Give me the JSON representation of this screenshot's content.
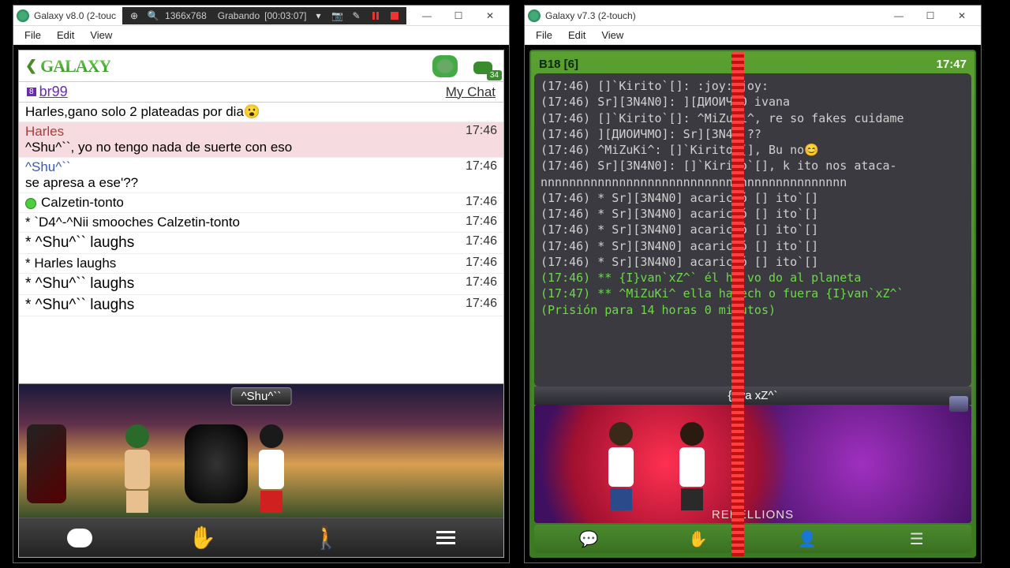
{
  "left_window": {
    "title": "Galaxy v8.0 (2-touc",
    "rec": {
      "res": "1366x768",
      "label": "Grabando",
      "time": "[00:03:07]"
    },
    "menu": [
      "File",
      "Edit",
      "View"
    ],
    "header": {
      "logo": "GALAXY",
      "people_badge": "34"
    },
    "sub": {
      "room_tag": "8",
      "room": "br99",
      "mychat": "My Chat"
    },
    "messages": [
      {
        "type": "plain",
        "text": "Harles,gano solo 2 plateadas por dia😮",
        "time": ""
      },
      {
        "type": "named",
        "name": "Harles",
        "name_class": "name-red",
        "text": "^Shu^``, yo no tengo nada de suerte con eso",
        "row_class": "pink",
        "time": "17:46"
      },
      {
        "type": "named",
        "name": "^Shu^``",
        "name_class": "name-blue",
        "text": "se apresa a ese'??",
        "time": "17:46"
      },
      {
        "type": "status",
        "text": "Calzetin-tonto",
        "dot": true,
        "time": "17:46"
      },
      {
        "type": "emote",
        "text": "* `D4^-^Nii smooches Calzetin-tonto",
        "time": "17:46"
      },
      {
        "type": "emote",
        "text": "* ^Shu^`` laughs",
        "time": "17:46",
        "big": true
      },
      {
        "type": "emote",
        "text": "* Harles laughs",
        "time": "17:46"
      },
      {
        "type": "emote",
        "text": "* ^Shu^`` laughs",
        "time": "17:46",
        "big": true
      },
      {
        "type": "emote",
        "text": "* ^Shu^`` laughs",
        "time": "17:46",
        "big": true
      }
    ],
    "selected_avatar": "^Shu^``"
  },
  "right_window": {
    "title": "Galaxy v7.3 (2-touch)",
    "menu": [
      "File",
      "Edit",
      "View"
    ],
    "top": {
      "room": "B18 [6]",
      "clock": "17:47"
    },
    "lines": [
      "(17:46) []`Kirito`[]: :joy::joy:",
      "(17:46) Sr][3N4N0]: ][ДИОИЧМО     ivana",
      "(17:46) []`Kirito`[]: ^MiZuKi^, re   so fakes cuidame",
      "(17:46) ][ДИОИЧМО]: Sr][3N4N   ??",
      "(17:46) ^MiZuKi^: []`Kirito`[], Bu   no😊",
      "(17:46) Sr][3N4N0]: []`Kirito`[], k  ito nos ataca-nnnnnnnnnnnnnnnnnnnnnnnnnnnnnnnnnnnnnnnnnnn",
      "(17:46) * Sr][3N4N0] acarició []   ito`[]",
      "(17:46) * Sr][3N4N0] acarició []   ito`[]",
      "(17:46) * Sr][3N4N0] acarició []   ito`[]",
      "(17:46) * Sr][3N4N0] acarició []   ito`[]",
      "(17:46) * Sr][3N4N0] acarició []   ito`[]"
    ],
    "green1": "(17:46) ** {I}van`xZ^` él ha vo   do al planeta",
    "green2": "(17:47) ** ^MiZuKi^ ella ha ech   o fuera {I}van`xZ^` (Prisión para 14 horas 0 minutos)",
    "selected": "{I}va  xZ^`",
    "clan": "REBELLIONS"
  }
}
